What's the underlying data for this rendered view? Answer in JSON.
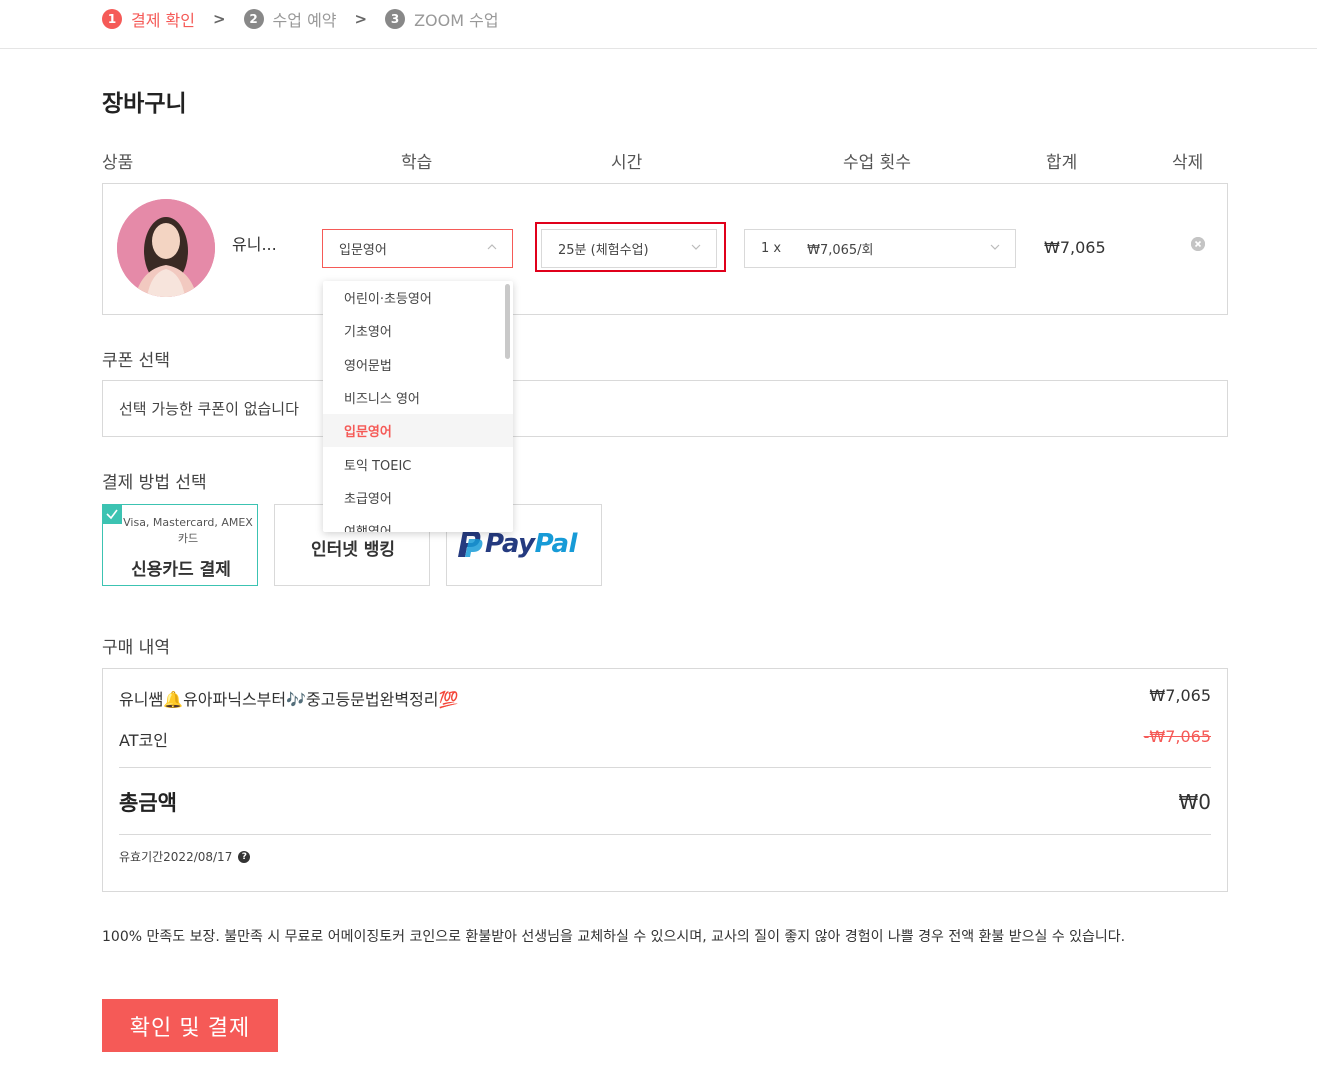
{
  "steps": [
    {
      "num": "1",
      "label": "결제 확인"
    },
    {
      "num": "2",
      "label": "수업 예약"
    },
    {
      "num": "3",
      "label": "ZOOM 수업"
    }
  ],
  "step_sep": ">",
  "title": "장바구니",
  "table_headers": {
    "product": "상품",
    "study": "학습",
    "time": "시간",
    "count": "수업 횟수",
    "total": "합계",
    "delete": "삭제"
  },
  "cart": {
    "product_name": "유니...",
    "study_value": "입문영어",
    "time_value": "25분 (체험수업)",
    "count_value": "1 x",
    "count_price": "₩7,065/회",
    "sum": "₩7,065"
  },
  "study_options": [
    "어린이·초등영어",
    "기초영어",
    "영어문법",
    "비즈니스 영어",
    "입문영어",
    "토익 TOEIC",
    "초급영어",
    "여행영어"
  ],
  "coupon": {
    "label": "쿠폰 선택",
    "placeholder": "선택 가능한 쿠폰이 없습니다"
  },
  "payment": {
    "label": "결제 방법 선택",
    "credit_sub_1": "Visa, Mastercard, AMEX",
    "credit_sub_2": "카드",
    "credit_main": "신용카드 결제",
    "bank_main": "인터넷 뱅킹",
    "paypal_1": "Pay",
    "paypal_2": "Pal"
  },
  "history": {
    "label": "구매 내역",
    "item_name": "유니쌤🔔유아파닉스부터🎶중고등문법완벽정리💯",
    "item_price": "₩7,065",
    "coin_label": "AT코인",
    "coin_value": "-₩7,065",
    "total_label": "총금액",
    "total_value": "₩0",
    "validity": "유효기간2022/08/17",
    "help_glyph": "?"
  },
  "notice": "100% 만족도 보장. 불만족 시 무료로 어메이징토커 코인으로 환불받아 선생님을 교체하실 수 있으시며, 교사의 질이 좋지 않아 경험이 나쁠 경우 전액 환불 받으실 수 있습니다.",
  "confirm_button": "확인 및 결제",
  "colors": {
    "accent": "#f55a57",
    "teal": "#3cc3b2",
    "highlight": "#e0001b"
  }
}
